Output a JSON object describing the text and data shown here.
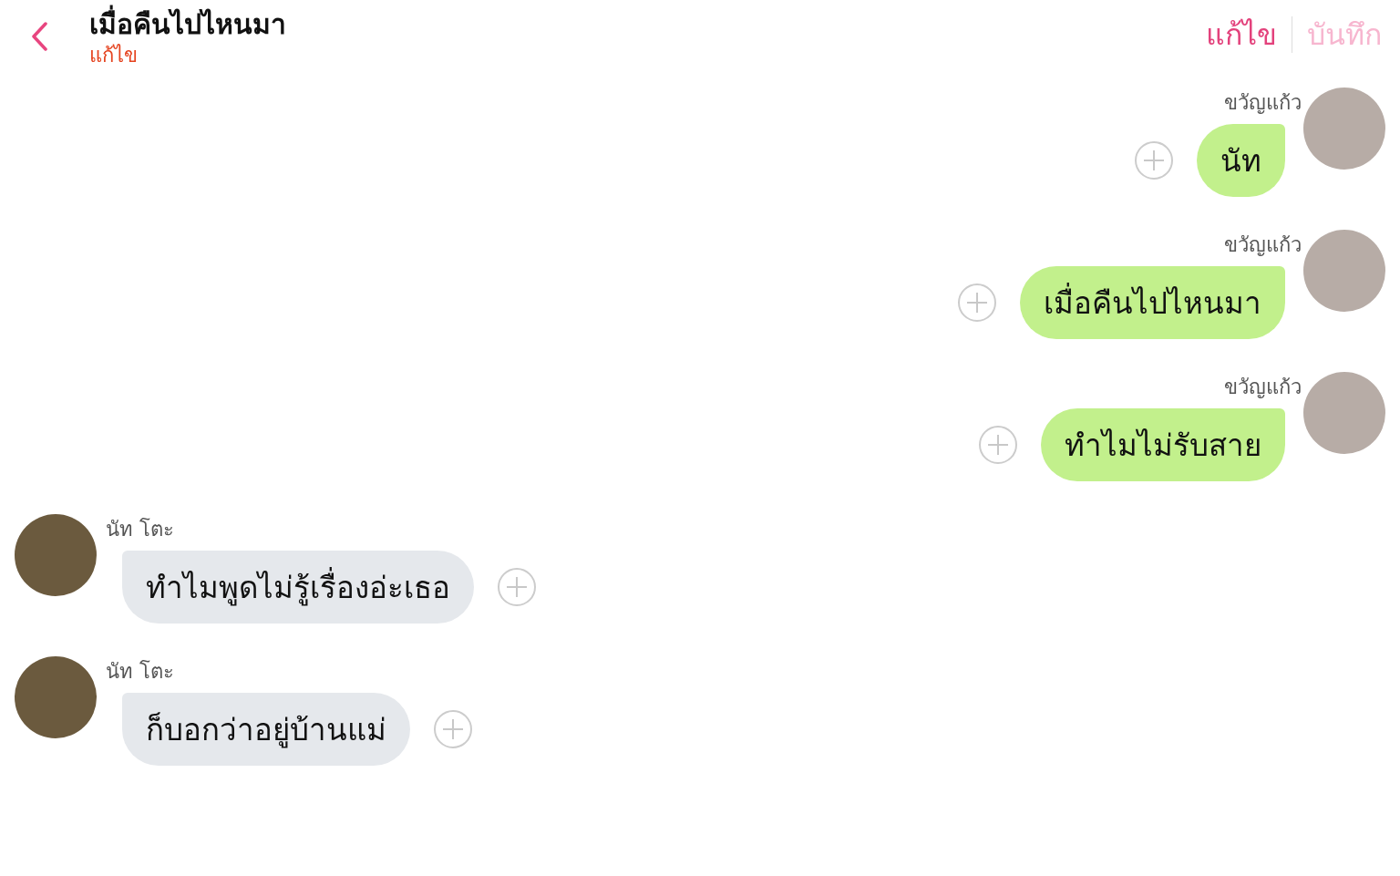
{
  "header": {
    "title": "เมื่อคืนไปไหนมา",
    "subtitle": "แก้ไข",
    "actions": [
      {
        "label": "แก้ไข",
        "disabled": false
      },
      {
        "label": "บันทึก",
        "disabled": true
      }
    ]
  },
  "messages": [
    {
      "kind": "outgoing",
      "sender": "ขวัญแก้ว",
      "text": "นัท"
    },
    {
      "kind": "outgoing",
      "sender": "ขวัญแก้ว",
      "text": "เมื่อคืนไปไหนมา"
    },
    {
      "kind": "outgoing",
      "sender": "ขวัญแก้ว",
      "text": "ทำไมไม่รับสาย"
    },
    {
      "kind": "incoming",
      "sender": "นัท โตะ",
      "text": "ทำไมพูดไม่รู้เรื่องอ่ะเธอ"
    },
    {
      "kind": "incoming",
      "sender": "นัท โตะ",
      "text": "ก็บอกว่าอยู่บ้านแม่"
    }
  ]
}
